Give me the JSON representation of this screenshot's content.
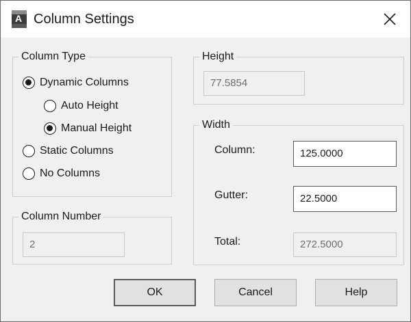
{
  "window": {
    "title": "Column Settings",
    "app_icon": "autocad-app-icon",
    "app_icon_letter": "A",
    "close_icon": "close-icon"
  },
  "column_type": {
    "legend": "Column Type",
    "options": [
      {
        "label": "Dynamic Columns",
        "checked": true
      },
      {
        "label": "Auto Height",
        "checked": false
      },
      {
        "label": "Manual Height",
        "checked": true
      },
      {
        "label": "Static Columns",
        "checked": false
      },
      {
        "label": "No Columns",
        "checked": false
      }
    ]
  },
  "column_number": {
    "legend": "Column Number",
    "value": "2"
  },
  "height": {
    "legend": "Height",
    "value": "77.5854"
  },
  "width": {
    "legend": "Width",
    "column_label": "Column:",
    "column_value": "125.0000",
    "gutter_label": "Gutter:",
    "gutter_value": "22.5000",
    "total_label": "Total:",
    "total_value": "272.5000"
  },
  "buttons": {
    "ok": "OK",
    "cancel": "Cancel",
    "help": "Help"
  }
}
